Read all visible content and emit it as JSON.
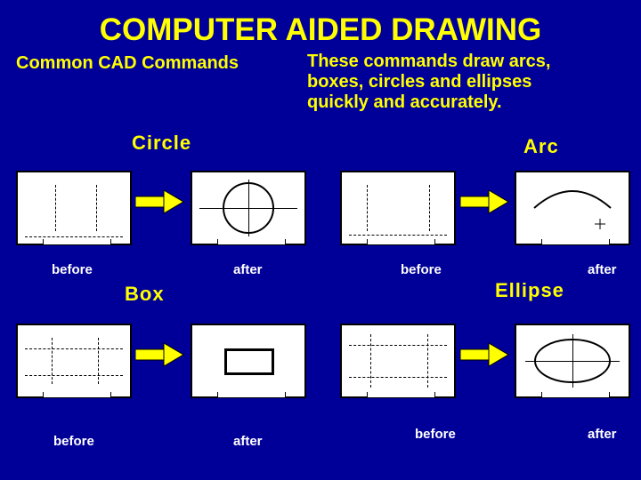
{
  "title": "COMPUTER AIDED DRAWING",
  "subtitle": "Common CAD Commands",
  "description": "These commands draw arcs, boxes, circles and ellipses quickly and accurately.",
  "commands": {
    "circle": "Circle",
    "arc": "Arc",
    "box": "Box",
    "ellipse": "Ellipse"
  },
  "labels": {
    "before": "before",
    "after": "after"
  }
}
